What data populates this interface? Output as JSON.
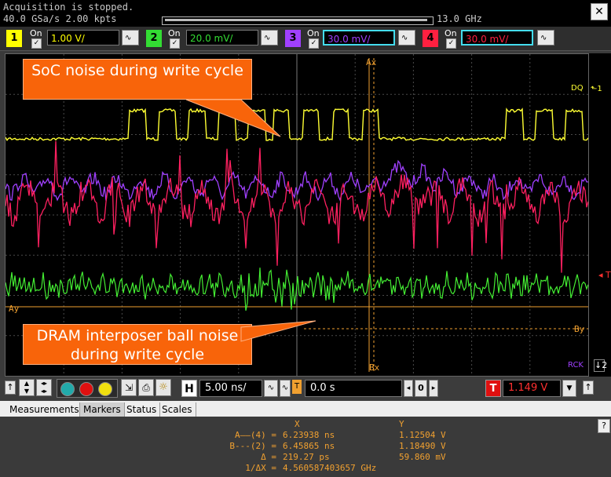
{
  "status": {
    "acquisition": "Acquisition is stopped.",
    "rate": "40.0 GSa/s   2.00 kpts",
    "bandwidth": "13.0 GHz"
  },
  "channels": [
    {
      "num": "1",
      "on": "On",
      "scale": "1.00 V/",
      "color": "#ffff00"
    },
    {
      "num": "2",
      "on": "On",
      "scale": "20.0 mV/",
      "color": "#33dd33"
    },
    {
      "num": "3",
      "on": "On",
      "scale": "30.0 mV/",
      "color": "#a040ff"
    },
    {
      "num": "4",
      "on": "On",
      "scale": "30.0 mV/",
      "color": "#ff2040"
    }
  ],
  "callouts": {
    "soc": "SoC noise during write cycle",
    "dram": "DRAM interposer ball noise during write cycle"
  },
  "markers_on_screen": {
    "ax": "Ax",
    "bx": "Bx",
    "ay": "Ay",
    "by": "By"
  },
  "trace_labels": {
    "dq": "DQ",
    "rck": "RCK",
    "trig": "T"
  },
  "timebase": {
    "h_label": "H",
    "scale": "5.00 ns/",
    "delay_icon": "T",
    "position": "0.0 s",
    "pos_value": "0",
    "trigger_icon": "T",
    "trigger_level": "1.149 V"
  },
  "tabs": [
    "Measurements",
    "Markers",
    "Status",
    "Scales"
  ],
  "active_tab": "Markers",
  "markers": {
    "hdr_x": "X",
    "hdr_y": "Y",
    "rows": [
      {
        "label": "A——(4) =",
        "x": "6.23938 ns",
        "y": "1.12504 V"
      },
      {
        "label": "B---(2) =",
        "x": "6.45865 ns",
        "y": "1.18490 V"
      },
      {
        "label": "Δ =",
        "x": "219.27 ps",
        "y": "59.860 mV"
      },
      {
        "label": "1/ΔX =",
        "x": "4.560587403657 GHz",
        "y": ""
      }
    ]
  },
  "colors": {
    "ch1": "#ffff00",
    "ch2": "#33dd33",
    "ch3": "#a040ff",
    "ch4": "#ff2040",
    "marker": "#f0a030",
    "callout": "#f8640a"
  }
}
